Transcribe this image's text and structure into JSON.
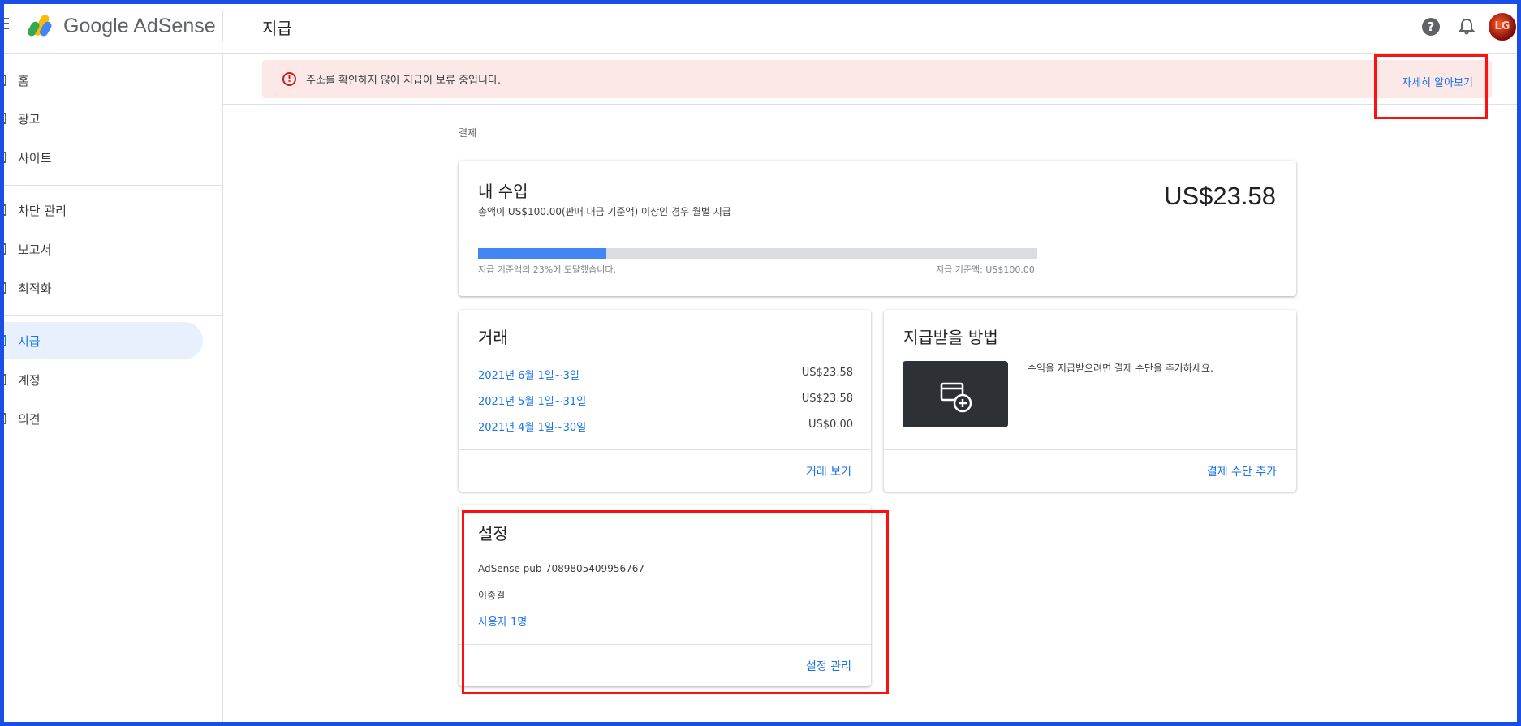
{
  "app": {
    "name": "Google AdSense",
    "page_title": "지급",
    "avatar_text": "LG"
  },
  "sidebar": {
    "items": [
      {
        "label": "홈"
      },
      {
        "label": "광고"
      },
      {
        "label": "사이트"
      },
      {
        "label": "차단 관리"
      },
      {
        "label": "보고서"
      },
      {
        "label": "최적화"
      },
      {
        "label": "지급",
        "active": true
      },
      {
        "label": "계정"
      },
      {
        "label": "의견"
      }
    ]
  },
  "alert": {
    "text": "주소를 확인하지 않아 지급이 보류 중입니다.",
    "link": "자세히 알아보기"
  },
  "breadcrumb": "결제",
  "earnings": {
    "title": "내 수입",
    "subtitle": "총액이 US$100.00(판매 대금 기준액) 이상인 경우 월별 지급",
    "amount": "US$23.58",
    "progress_fraction": 0.23,
    "progress_text": "지급 기준액의 23%에 도달했습니다.",
    "threshold_text": "지급 기준액: US$100.00"
  },
  "transactions": {
    "title": "거래",
    "rows": [
      {
        "date": "2021년 6월 1일~3일",
        "amount": "US$23.58"
      },
      {
        "date": "2021년 5월 1일~31일",
        "amount": "US$23.58"
      },
      {
        "date": "2021년 4월 1일~30일",
        "amount": "US$0.00"
      }
    ],
    "footer_link": "거래 보기"
  },
  "payment_method": {
    "title": "지급받을 방법",
    "description": "수익을 지급받으려면 결제 수단을 추가하세요.",
    "footer_link": "결제 수단 추가"
  },
  "settings": {
    "title": "설정",
    "publisher_id": "AdSense pub-7089805409956767",
    "name": "이종걸",
    "users_link": "사용자 1명",
    "footer_link": "설정 관리"
  },
  "colors": {
    "accent": "#1a73e8",
    "progress": "#4285f4",
    "alert_bg": "#fce8e6",
    "alert_icon": "#c5221f",
    "highlight_box": "#ff1010",
    "frame": "#1a4fe6"
  }
}
